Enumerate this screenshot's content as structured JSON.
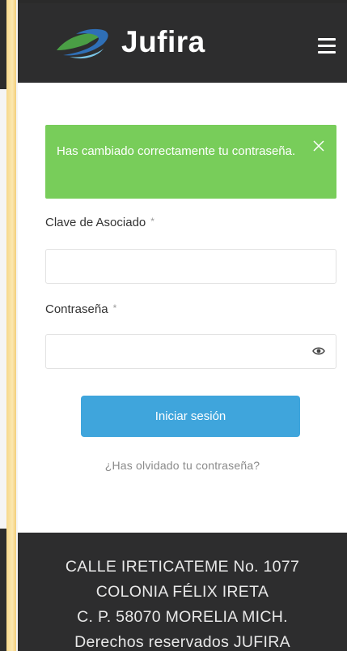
{
  "header": {
    "brand": "Jufira",
    "logo_icon": "hands-logo-icon",
    "menu_icon": "hamburger-menu-icon"
  },
  "alert": {
    "message": "Has cambiado correctamente tu contraseña.",
    "close_icon": "close-icon",
    "color": "#78cd5a"
  },
  "form": {
    "username_label": "Clave de Asociado",
    "password_label": "Contraseña",
    "required_marker": "*",
    "username_value": "",
    "password_value": "",
    "eye_icon": "eye-icon",
    "submit_label": "Iniciar sesión",
    "forgot_link": "¿Has olvidado tu contraseña?",
    "button_color": "#3fa5dc"
  },
  "footer": {
    "lines": [
      "CALLE IRETICATEME No. 1077",
      "COLONIA FÉLIX IRETA",
      "C. P. 58070 MORELIA MICH.",
      "Derechos reservados JUFIRA"
    ]
  }
}
